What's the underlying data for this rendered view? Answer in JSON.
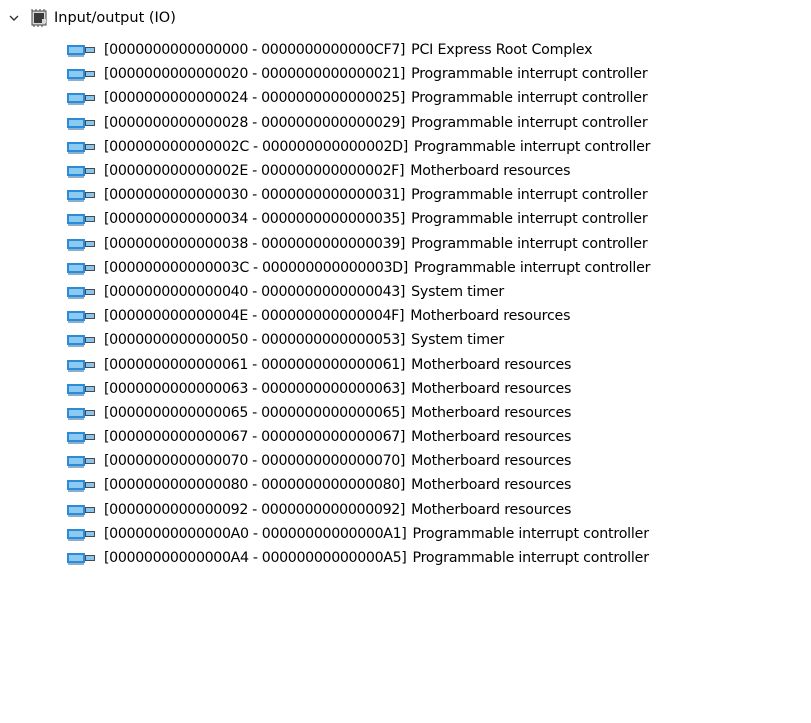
{
  "tree": {
    "root": {
      "label": "Input/output (IO)",
      "expand_icon": "chevron-down-icon",
      "device_icon": "io-device-icon"
    },
    "items": [
      {
        "range": "[0000000000000000 - 0000000000000CF7]",
        "name": "PCI Express Root Complex"
      },
      {
        "range": "[0000000000000020 - 0000000000000021]",
        "name": "Programmable interrupt controller"
      },
      {
        "range": "[0000000000000024 - 0000000000000025]",
        "name": "Programmable interrupt controller"
      },
      {
        "range": "[0000000000000028 - 0000000000000029]",
        "name": "Programmable interrupt controller"
      },
      {
        "range": "[000000000000002C - 000000000000002D]",
        "name": "Programmable interrupt controller"
      },
      {
        "range": "[000000000000002E - 000000000000002F]",
        "name": "Motherboard resources"
      },
      {
        "range": "[0000000000000030 - 0000000000000031]",
        "name": "Programmable interrupt controller"
      },
      {
        "range": "[0000000000000034 - 0000000000000035]",
        "name": "Programmable interrupt controller"
      },
      {
        "range": "[0000000000000038 - 0000000000000039]",
        "name": "Programmable interrupt controller"
      },
      {
        "range": "[000000000000003C - 000000000000003D]",
        "name": "Programmable interrupt controller"
      },
      {
        "range": "[0000000000000040 - 0000000000000043]",
        "name": "System timer"
      },
      {
        "range": "[000000000000004E - 000000000000004F]",
        "name": "Motherboard resources"
      },
      {
        "range": "[0000000000000050 - 0000000000000053]",
        "name": "System timer"
      },
      {
        "range": "[0000000000000061 - 0000000000000061]",
        "name": "Motherboard resources"
      },
      {
        "range": "[0000000000000063 - 0000000000000063]",
        "name": "Motherboard resources"
      },
      {
        "range": "[0000000000000065 - 0000000000000065]",
        "name": "Motherboard resources"
      },
      {
        "range": "[0000000000000067 - 0000000000000067]",
        "name": "Motherboard resources"
      },
      {
        "range": "[0000000000000070 - 0000000000000070]",
        "name": "Motherboard resources"
      },
      {
        "range": "[0000000000000080 - 0000000000000080]",
        "name": "Motherboard resources"
      },
      {
        "range": "[0000000000000092 - 0000000000000092]",
        "name": "Motherboard resources"
      },
      {
        "range": "[00000000000000A0 - 00000000000000A1]",
        "name": "Programmable interrupt controller"
      },
      {
        "range": "[00000000000000A4 - 00000000000000A5]",
        "name": "Programmable interrupt controller"
      }
    ],
    "item_icon": "pci-device-icon",
    "colors": {
      "text": "#000000",
      "icon_blue": "#1e90d8",
      "icon_dark": "#4a4a4a"
    }
  }
}
